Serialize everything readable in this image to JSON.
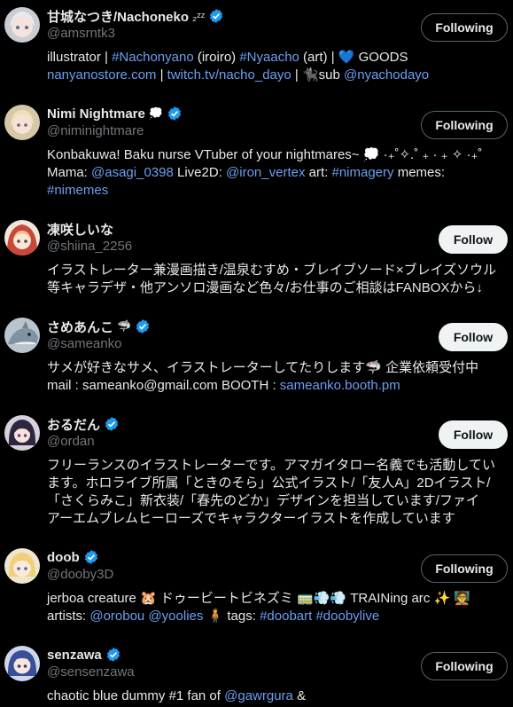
{
  "colors": {
    "background": "#000000",
    "text": "#e7e9ea",
    "muted": "#71767b",
    "link": "#6c9ff0",
    "verified": "#1d9bf0"
  },
  "users": [
    {
      "name": "甘城なつき/Nachoneko",
      "name_suffix": "₂ᶻᶻ",
      "verified": true,
      "handle": "@amsrntk3",
      "button": "Following",
      "button_type": "following",
      "avatar_icon": "avatar-silver-hair",
      "bio_line1": {
        "a": "illustrator | ",
        "b": "#Nachonyano",
        "c": " (iroiro) ",
        "d": "#Nyaacho",
        "e": " (art) | 💙 GOODS"
      },
      "bio_line2": {
        "a": "nanyanostore.com",
        "b": " | ",
        "c": "twitch.tv/nacho_dayo",
        "d": " | 🐈‍⬛sub ",
        "e": "@nyachodayo"
      }
    },
    {
      "name": "Nimi Nightmare",
      "name_suffix": "💭",
      "verified": true,
      "handle": "@niminightmare",
      "button": "Following",
      "button_type": "following",
      "avatar_icon": "avatar-blonde",
      "bio_line1": {
        "a": "Konbakuwa! Baku nurse VTuber of your nightmares~ 💭 ·₊˚✧.˚ ₊ · ₊ ✧ ·₊˚"
      },
      "bio_line2": {
        "a": "Mama: ",
        "b": "@asagi_0398",
        "c": " Live2D: ",
        "d": "@iron_vertex",
        "e": " art: ",
        "f": "#nimagery",
        "g": " memes:"
      },
      "bio_line3": {
        "a": "#nimemes"
      }
    },
    {
      "name": "凍咲しいな",
      "name_suffix": "",
      "verified": false,
      "handle": "@shiina_2256",
      "button": "Follow",
      "button_type": "follow",
      "avatar_icon": "avatar-red-hood",
      "bio_line1": {
        "a": "イラストレーター兼漫画描き/温泉むすめ・ブレイブソード×ブレイズソウル"
      },
      "bio_line2": {
        "a": "等キャラデザ・他アンソロ漫画など色々/お仕事のご相談はFANBOXから↓"
      }
    },
    {
      "name": "さめあんこ",
      "name_suffix": "🦈",
      "verified": true,
      "handle": "@sameanko",
      "button": "Follow",
      "button_type": "follow",
      "avatar_icon": "avatar-shark",
      "bio_line1": {
        "a": "サメが好きなサメ、イラストレーターしてたりします🦈 企業依頼受付中"
      },
      "bio_line2": {
        "a": "mail : sameanko@gmail.com BOOTH : ",
        "b": "sameanko.booth.pm"
      }
    },
    {
      "name": "おるだん",
      "name_suffix": "",
      "verified": true,
      "handle": "@ordan",
      "button": "Follow",
      "button_type": "follow",
      "avatar_icon": "avatar-dark-hair",
      "bio_line1": {
        "a": "フリーランスのイラストレーターです。アマガイタロー名義でも活動してい"
      },
      "bio_line2": {
        "a": "ます。ホロライブ所属「ときのそら」公式イラスト/「友人A」2Dイラスト/"
      },
      "bio_line3": {
        "a": "「さくらみこ」新衣装/「春先のどか」デザインを担当しています/ファイ"
      },
      "bio_line4": {
        "a": "アーエムブレムヒーローズでキャラクターイラストを作成しています"
      }
    },
    {
      "name": "doob",
      "name_suffix": "",
      "verified": true,
      "handle": "@dooby3D",
      "button": "Following",
      "button_type": "following",
      "avatar_icon": "avatar-blonde-girl",
      "bio_line1": {
        "a": "jerboa creature 🐹 ドゥービートビネズミ 🚃💨💨 TRAINing arc ✨ 🧑‍🏫"
      },
      "bio_line2": {
        "a": "artists: ",
        "b": "@orobou",
        "c": " ",
        "d": "@yoolies",
        "e": " 🧍 tags: ",
        "f": "#doobart",
        "g": " ",
        "h": "#doobylive"
      }
    },
    {
      "name": "senzawa",
      "name_suffix": "",
      "verified": true,
      "handle": "@sensenzawa",
      "button": "Following",
      "button_type": "following",
      "avatar_icon": "avatar-blue-hair",
      "bio_line1": {
        "a": "chaotic blue dummy #1 fan of ",
        "b": "@gawrgura",
        "c": " &"
      }
    }
  ]
}
